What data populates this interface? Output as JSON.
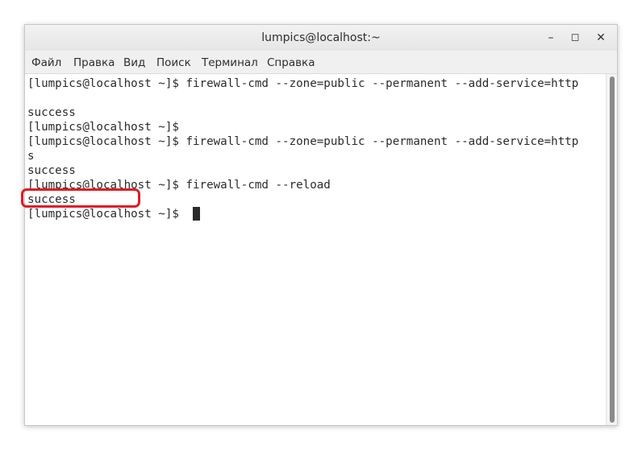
{
  "window": {
    "title": "lumpics@localhost:~",
    "controls": {
      "minimize": "–",
      "maximize": "◻",
      "close": "✕"
    }
  },
  "menu": {
    "items": [
      "Файл",
      "Правка",
      "Вид",
      "Поиск",
      "Терминал",
      "Справка"
    ]
  },
  "terminal": {
    "lines": [
      "[lumpics@localhost ~]$ firewall-cmd --zone=public --permanent --add-service=http",
      "",
      "success",
      "[lumpics@localhost ~]$",
      "[lumpics@localhost ~]$ firewall-cmd --zone=public --permanent --add-service=http",
      "s",
      "success",
      "[lumpics@localhost ~]$ firewall-cmd --reload",
      "success",
      "[lumpics@localhost ~]$ "
    ]
  },
  "highlight_color": "#e01b24"
}
